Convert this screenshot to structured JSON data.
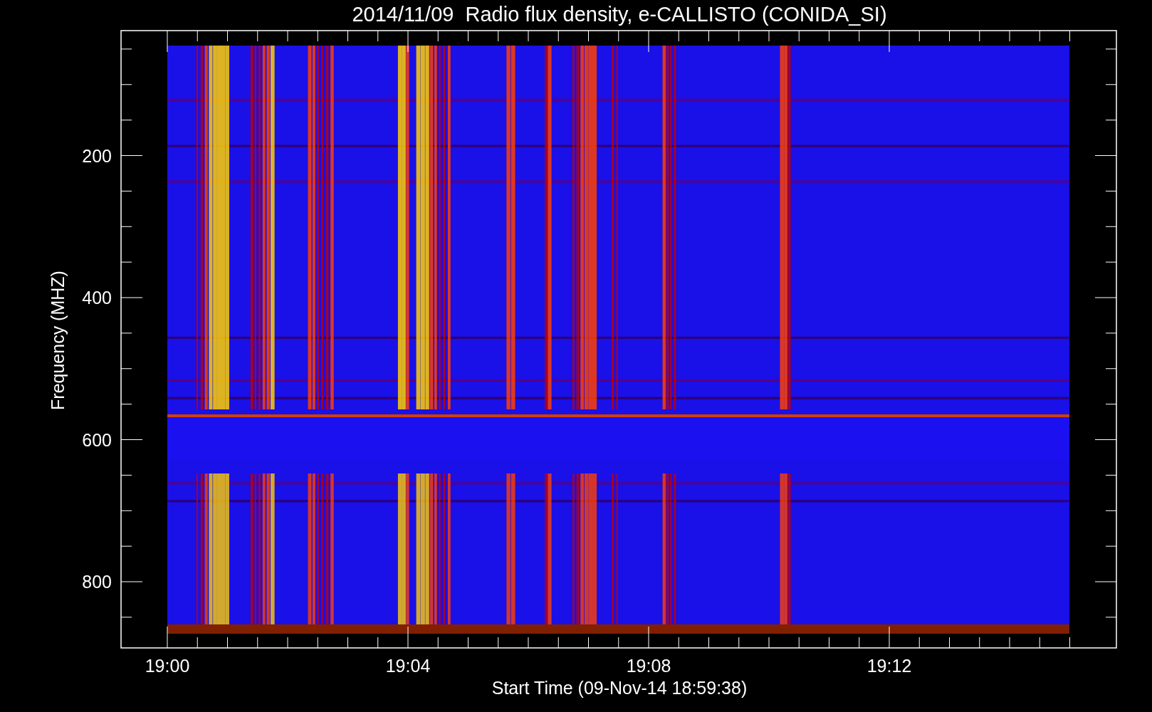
{
  "title": "2014/11/09  Radio flux density, e-CALLISTO (CONIDA_SI)",
  "ylabel": "Frequency (MHZ)",
  "xlabel": "Start Time (09-Nov-14 18:59:38)",
  "yticks": [
    "200",
    "400",
    "600",
    "800"
  ],
  "xticks": [
    "19:00",
    "19:04",
    "19:08",
    "19:12"
  ]
}
